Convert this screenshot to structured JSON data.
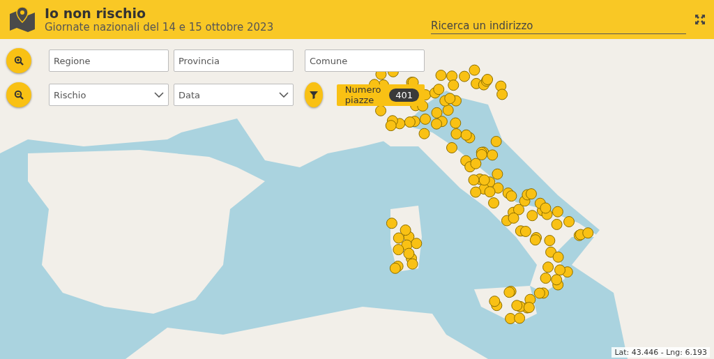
{
  "header": {
    "title": "Io non rischio",
    "subtitle": "Giornate nazionali del 14 e 15 ottobre 2023",
    "search": {
      "placeholder": "Ricerca un indirizzo"
    }
  },
  "filters": [
    {
      "kind": "text",
      "placeholder": "Regione"
    },
    {
      "kind": "text",
      "placeholder": "Provincia"
    },
    {
      "kind": "text",
      "placeholder": "Comune"
    },
    {
      "kind": "select",
      "placeholder": "Rischio"
    },
    {
      "kind": "select",
      "placeholder": "Data"
    }
  ],
  "count_badge": {
    "label": "Numero piazze",
    "count": "401"
  },
  "coordinates": "Lat: 43.446 - Lng: 6.193"
}
